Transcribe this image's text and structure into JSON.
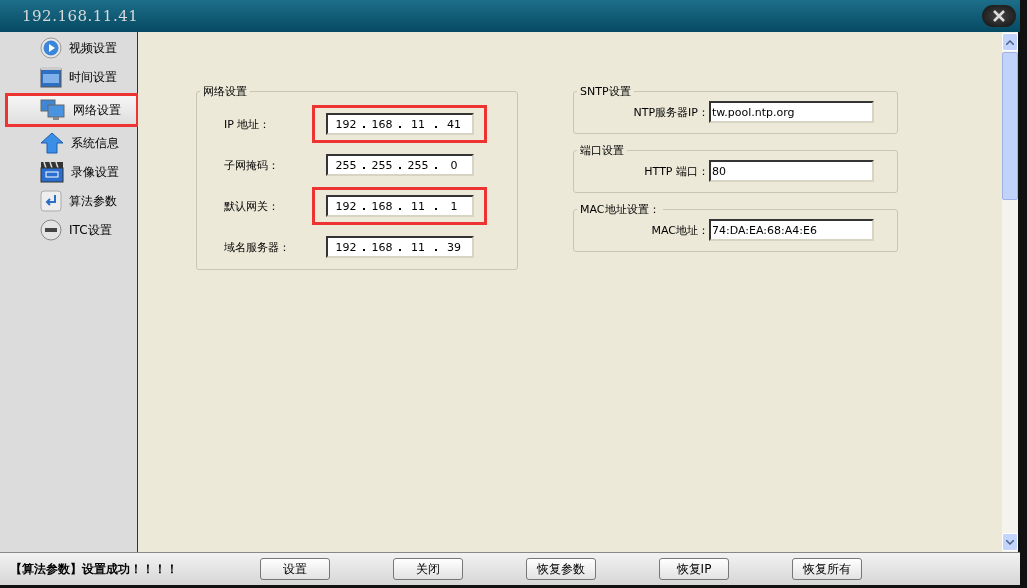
{
  "window": {
    "title": "192.168.11.41"
  },
  "sidebar": {
    "items": [
      {
        "label": "视频设置",
        "kind": "play",
        "selected": false
      },
      {
        "label": "时间设置",
        "kind": "calendar",
        "selected": false
      },
      {
        "label": "网络设置",
        "kind": "monitors",
        "selected": true
      },
      {
        "label": "系统信息",
        "kind": "arrow",
        "selected": false
      },
      {
        "label": "录像设置",
        "kind": "clapper",
        "selected": false
      },
      {
        "label": "算法参数",
        "kind": "enter",
        "selected": false
      },
      {
        "label": "ITC设置",
        "kind": "badge",
        "selected": false
      }
    ]
  },
  "network_group": {
    "title": "网络设置",
    "rows": [
      {
        "label": "IP 地址：",
        "octets": [
          "192",
          "168",
          "11",
          "41"
        ],
        "highlighted": true
      },
      {
        "label": "子网掩码：",
        "octets": [
          "255",
          "255",
          "255",
          "0"
        ],
        "highlighted": false
      },
      {
        "label": "默认网关：",
        "octets": [
          "192",
          "168",
          "11",
          "1"
        ],
        "highlighted": true
      },
      {
        "label": "域名服务器：",
        "octets": [
          "192",
          "168",
          "11",
          "39"
        ],
        "highlighted": false
      }
    ]
  },
  "right_groups": [
    {
      "title": "SNTP设置",
      "label": "NTP服务器IP：",
      "value": "tw.pool.ntp.org"
    },
    {
      "title": "端口设置",
      "label": "HTTP 端口：",
      "value": "80"
    },
    {
      "title": "MAC地址设置：",
      "label": "MAC地址：",
      "value": "74:DA:EA:68:A4:E6"
    }
  ],
  "status_bar": {
    "message": "【算法参数】设置成功！！！！",
    "buttons": [
      "设置",
      "关闭",
      "恢复参数",
      "恢复IP",
      "恢复所有"
    ]
  }
}
